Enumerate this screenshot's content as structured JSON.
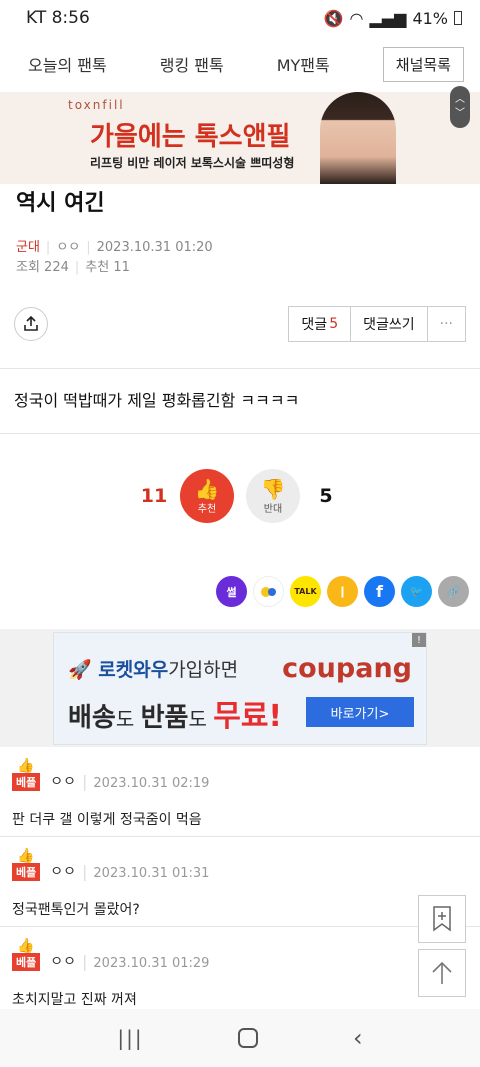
{
  "status": {
    "carrier_time": "KT 8:56",
    "battery": "41%"
  },
  "nav": {
    "tabs": [
      "오늘의 팬톡",
      "랭킹 팬톡",
      "MY팬톡"
    ],
    "channel_button": "채널목록"
  },
  "ad_top": {
    "brand": "toxnfill",
    "headline": "가을에는 톡스앤필",
    "sub": "리프팅 비만 레이저 보톡스시술 쁘띠성형"
  },
  "post": {
    "title": "역시 여긴",
    "category": "군대",
    "author": "ㅇㅇ",
    "date": "2023.10.31 01:20",
    "views": "조회 224",
    "recommends": "추천 11",
    "body": "정국이 떡밥때가 제일 평화롭긴함 ㅋㅋㅋㅋ"
  },
  "actions": {
    "comment_label": "댓글",
    "comment_count": "5",
    "write_comment": "댓글쓰기",
    "more": "···"
  },
  "votes": {
    "up_count": "11",
    "up_label": "추천",
    "down_label": "반대",
    "down_count": "5"
  },
  "share": {
    "items": [
      "썰",
      "",
      "TALK",
      "",
      "f",
      "",
      ""
    ]
  },
  "ad_coupang": {
    "top_brand": "로켓와우",
    "top_rest": "가입하면",
    "logo": "coupang",
    "main_a": "배송",
    "main_b": "도 ",
    "main_c": "반품",
    "main_d": "도 ",
    "main_e": "무료!",
    "button": "바로가기>"
  },
  "comments": [
    {
      "badge": "베플",
      "author": "ㅇㅇ",
      "time": "2023.10.31 02:19",
      "text": "판 더쿠 갤 이렇게 정국줌이 먹음"
    },
    {
      "badge": "베플",
      "author": "ㅇㅇ",
      "time": "2023.10.31 01:31",
      "text": "정국팬톡인거 몰랐어?"
    },
    {
      "badge": "베플",
      "author": "ㅇㅇ",
      "time": "2023.10.31 01:29",
      "text": "초치지말고 진짜 꺼져"
    }
  ],
  "colors": {
    "accent": "#e8402f",
    "coupang_blue": "#2d6cdf"
  }
}
